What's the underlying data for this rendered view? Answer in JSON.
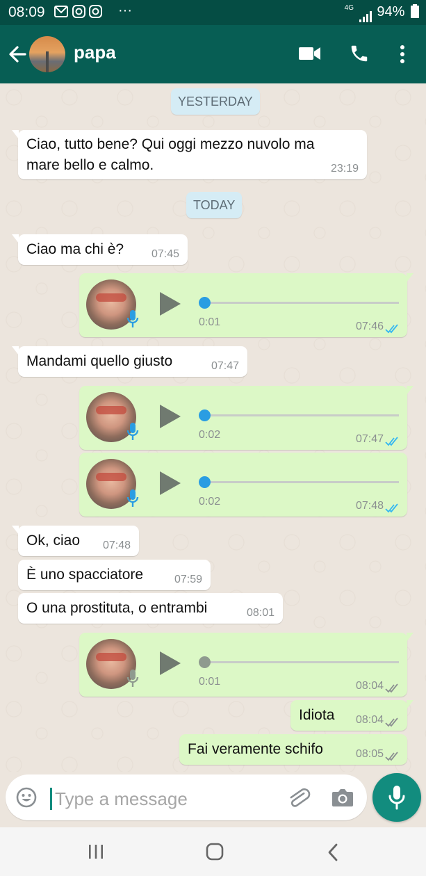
{
  "status": {
    "time": "08:09",
    "network": "4G",
    "battery": "94%"
  },
  "header": {
    "contact_name": "papa"
  },
  "chat": {
    "date_yesterday": "YESTERDAY",
    "date_today": "TODAY",
    "messages": [
      {
        "text": "Ciao, tutto bene? Qui oggi mezzo nuvolo ma",
        "text2": "mare bello e calmo.",
        "time": "23:19"
      },
      {
        "text": "Ciao ma chi è?",
        "time": "07:45"
      },
      {
        "duration": "0:01",
        "time": "07:46"
      },
      {
        "text": "Mandami quello giusto",
        "time": "07:47"
      },
      {
        "duration": "0:02",
        "time": "07:47"
      },
      {
        "duration": "0:02",
        "time": "07:48"
      },
      {
        "text": "Ok, ciao",
        "time": "07:48"
      },
      {
        "text": "È uno spacciatore",
        "time": "07:59"
      },
      {
        "text": "O una prostituta, o entrambi",
        "time": "08:01"
      },
      {
        "duration": "0:01",
        "time": "08:04"
      },
      {
        "text": "Idiota",
        "time": "08:04"
      },
      {
        "text": "Fai veramente schifo",
        "time": "08:05"
      }
    ]
  },
  "composer": {
    "placeholder": "Type a message"
  },
  "colors": {
    "header": "#075e54",
    "outgoing": "#dcf8c6",
    "accent": "#128c7e",
    "read_tick": "#34b7f1"
  }
}
